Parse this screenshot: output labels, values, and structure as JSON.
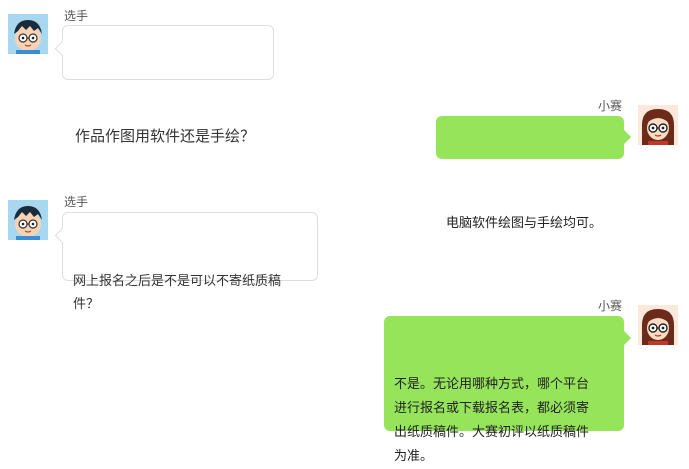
{
  "conversation": [
    {
      "sender": "选手",
      "side": "left",
      "avatar": "boy-avatar-icon",
      "text": "作品作图用软件还是手绘？"
    },
    {
      "sender": "小赛",
      "side": "right",
      "avatar": "girl-avatar-icon",
      "text": "电脑软件绘图与手绘均可。"
    },
    {
      "sender": "选手",
      "side": "left",
      "avatar": "boy-avatar-icon",
      "text": "网上报名之后是不是可以不寄纸质稿\n件？"
    },
    {
      "sender": "小赛",
      "side": "right",
      "avatar": "girl-avatar-icon",
      "text": "不是。无论用哪种方式，哪个平台\n进行报名或下载报名表，都必须寄\n出纸质稿件。大赛初评以纸质稿件\n为准。"
    }
  ],
  "colors": {
    "right_bubble": "#95e45a",
    "left_bubble": "#ffffff",
    "left_border": "#dedede"
  }
}
